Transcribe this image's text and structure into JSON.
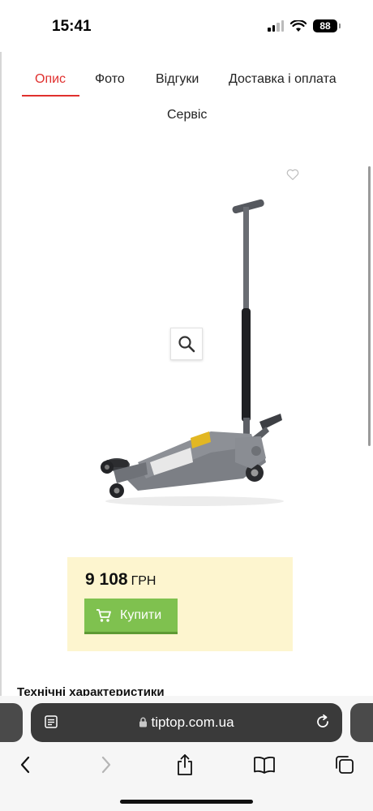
{
  "status_bar": {
    "time": "15:41",
    "battery": "88"
  },
  "tabs": [
    {
      "label": "Опис",
      "active": true
    },
    {
      "label": "Фото",
      "active": false
    },
    {
      "label": "Відгуки",
      "active": false
    },
    {
      "label": "Доставка і оплата",
      "active": false
    },
    {
      "label": "Сервіс",
      "active": false
    }
  ],
  "product": {
    "price": "9 108",
    "currency": "ГРН",
    "buy_label": "Купити"
  },
  "specs_heading": "Технічні характеристики",
  "browser": {
    "url": "tiptop.com.ua"
  },
  "colors": {
    "accent": "#e0302e",
    "buy": "#7fc14f",
    "price_bg": "#fdf5cf"
  },
  "icons": [
    "heart-icon",
    "zoom-icon",
    "cart-icon",
    "reader-icon",
    "lock-icon",
    "reload-icon",
    "back-icon",
    "forward-icon",
    "share-icon",
    "bookmarks-icon",
    "tabs-icon"
  ]
}
